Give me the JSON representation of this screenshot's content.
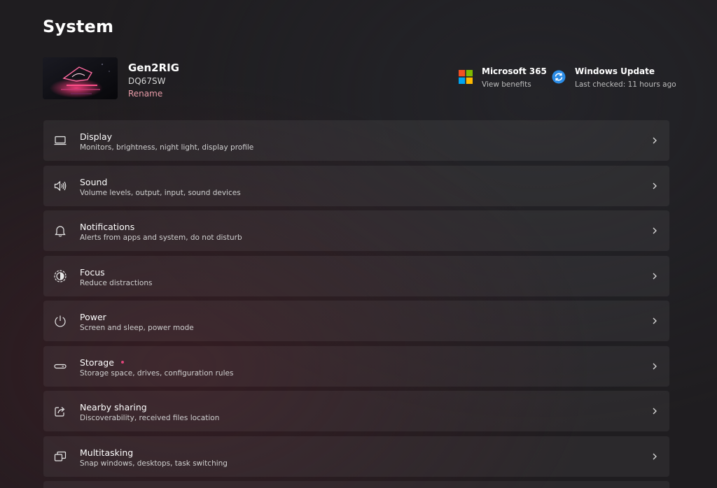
{
  "page": {
    "title": "System"
  },
  "device": {
    "name": "Gen2RIG",
    "model": "DQ67SW",
    "rename_label": "Rename"
  },
  "quick_links": {
    "microsoft365": {
      "title": "Microsoft 365",
      "subtitle": "View benefits",
      "icon": "microsoft-logo-icon"
    },
    "windows_update": {
      "title": "Windows Update",
      "subtitle": "Last checked: 11 hours ago",
      "icon": "windows-update-icon"
    }
  },
  "settings": [
    {
      "title": "Display",
      "subtitle": "Monitors, brightness, night light, display profile",
      "icon": "display-icon"
    },
    {
      "title": "Sound",
      "subtitle": "Volume levels, output, input, sound devices",
      "icon": "speaker-icon"
    },
    {
      "title": "Notifications",
      "subtitle": "Alerts from apps and system, do not disturb",
      "icon": "bell-icon"
    },
    {
      "title": "Focus",
      "subtitle": "Reduce distractions",
      "icon": "focus-icon"
    },
    {
      "title": "Power",
      "subtitle": "Screen and sleep, power mode",
      "icon": "power-icon"
    },
    {
      "title": "Storage",
      "subtitle": "Storage space, drives, configuration rules",
      "icon": "storage-icon"
    },
    {
      "title": "Nearby sharing",
      "subtitle": "Discoverability, received files location",
      "icon": "share-icon"
    },
    {
      "title": "Multitasking",
      "subtitle": "Snap windows, desktops, task switching",
      "icon": "multitasking-icon"
    }
  ],
  "colors": {
    "accent_link": "#e89ca8",
    "notification_dot": "#e0457a",
    "update_blue": "#2b8ce6"
  }
}
